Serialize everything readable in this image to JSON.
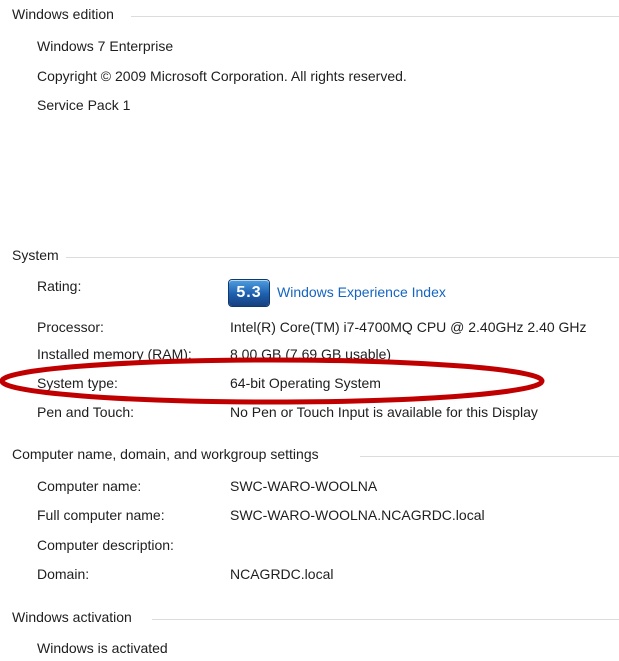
{
  "windows_edition": {
    "title": "Windows edition",
    "edition": "Windows 7 Enterprise",
    "copyright": "Copyright © 2009 Microsoft Corporation.  All rights reserved.",
    "service_pack": "Service Pack 1"
  },
  "system": {
    "title": "System",
    "rating_label": "Rating:",
    "rating_score": "5.3",
    "rating_link": "Windows Experience Index",
    "processor_label": "Processor:",
    "processor_value": "Intel(R) Core(TM) i7-4700MQ CPU @ 2.40GHz   2.40 GHz",
    "memory_label": "Installed memory (RAM):",
    "memory_value": "8.00 GB (7.69 GB usable)",
    "system_type_label": "System type:",
    "system_type_value": "64-bit Operating System",
    "pen_touch_label": "Pen and Touch:",
    "pen_touch_value": "No Pen or Touch Input is available for this Display"
  },
  "computer_name": {
    "title": "Computer name, domain, and workgroup settings",
    "name_label": "Computer name:",
    "name_value": "SWC-WARO-WOOLNA",
    "full_name_label": "Full computer name:",
    "full_name_value": "SWC-WARO-WOOLNA.NCAGRDC.local",
    "description_label": "Computer description:",
    "domain_label": "Domain:",
    "domain_value": "NCAGRDC.local"
  },
  "activation": {
    "title": "Windows activation",
    "status": "Windows is activated"
  },
  "annotation": {
    "ellipse_color": "#c00000"
  }
}
